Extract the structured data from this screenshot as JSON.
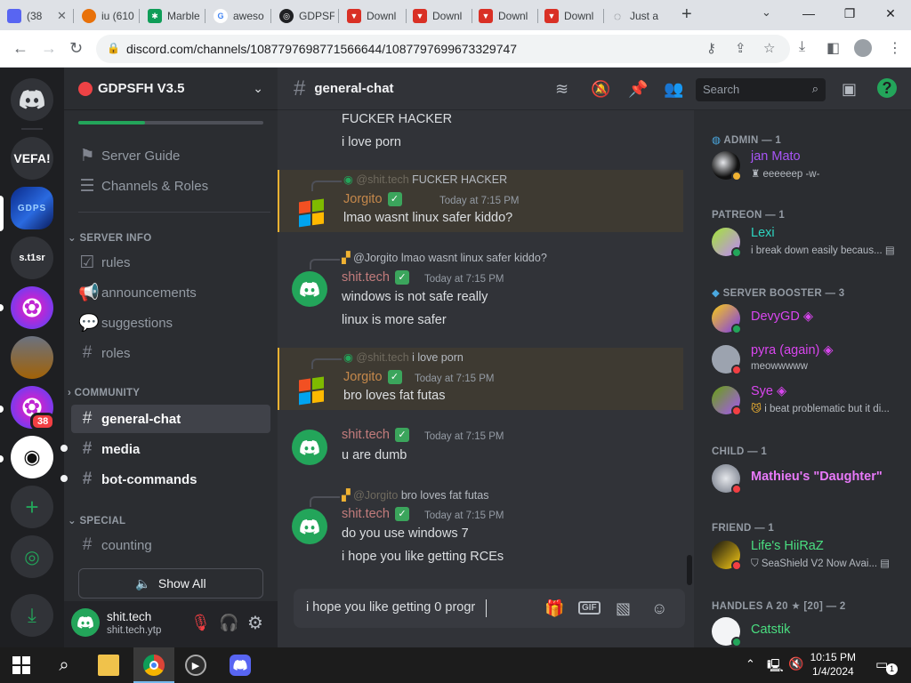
{
  "browser": {
    "tabs": [
      {
        "title": "(38",
        "favicon_color": "#5865f2",
        "favicon_text": "38"
      },
      {
        "title": "iu (610",
        "favicon_color": "#e8710a",
        "favicon_text": "●"
      },
      {
        "title": "Marble",
        "favicon_color": "#0f9d58",
        "favicon_text": "✱"
      },
      {
        "title": "aweso",
        "favicon_color": "#4285f4",
        "favicon_text": "G"
      },
      {
        "title": "GDPSF",
        "favicon_color": "#202124",
        "favicon_text": "◎"
      },
      {
        "title": "Downl",
        "favicon_color": "#d93025",
        "favicon_text": "▼"
      },
      {
        "title": "Downl",
        "favicon_color": "#d93025",
        "favicon_text": "▼"
      },
      {
        "title": "Downl",
        "favicon_color": "#d93025",
        "favicon_text": "▼"
      },
      {
        "title": "Downl",
        "favicon_color": "#d93025",
        "favicon_text": "▼"
      },
      {
        "title": "Just a",
        "favicon_color": "#5f6368",
        "favicon_text": "◌"
      }
    ],
    "url": "discord.com/channels/1087797698771566644/1087797699673329747"
  },
  "guilds": {
    "vefa_label": "VEFA!",
    "st1sr_label": "s.t1sr",
    "mention_badge": "38"
  },
  "server": {
    "name": "GDPSFH V3.5",
    "items_top": [
      {
        "label": "Server Guide",
        "icon": "signpost-icon"
      },
      {
        "label": "Channels & Roles",
        "icon": "list-icon"
      }
    ],
    "categories": [
      {
        "name": "SERVER INFO",
        "channels": [
          {
            "label": "rules",
            "icon": "rules-icon"
          },
          {
            "label": "announcements",
            "icon": "megaphone-icon"
          },
          {
            "label": "suggestions",
            "icon": "forum-icon"
          },
          {
            "label": "roles",
            "icon": "hash-icon"
          }
        ]
      },
      {
        "name": "COMMUNITY",
        "channels": [
          {
            "label": "general-chat",
            "icon": "hash-icon"
          },
          {
            "label": "media",
            "icon": "hash-icon"
          },
          {
            "label": "bot-commands",
            "icon": "hash-icon"
          }
        ]
      },
      {
        "name": "SPECIAL",
        "channels": [
          {
            "label": "counting",
            "icon": "hash-icon"
          }
        ]
      }
    ],
    "show_all_label": "Show All",
    "user": {
      "name": "shit.tech",
      "tag": "shit.tech.ytp"
    }
  },
  "chat": {
    "channel_name": "general-chat",
    "search_placeholder": "Search",
    "messages": [
      {
        "text1": "FUCKER HACKER",
        "text2": "i love porn"
      },
      {
        "reply_name": "@shit.tech",
        "reply_text": "FUCKER HACKER",
        "author": "Jorgito",
        "time": "Today at 7:15 PM",
        "text1": "lmao wasnt linux safer kiddo?"
      },
      {
        "reply_name": "@Jorgito",
        "reply_text": "lmao wasnt linux safer kiddo?",
        "author": "shit.tech",
        "time": "Today at 7:15 PM",
        "text1": "windows is not safe really",
        "text2": "linux is more safer"
      },
      {
        "reply_name": "@shit.tech",
        "reply_text": "i love porn",
        "author": "Jorgito",
        "time": "Today at 7:15 PM",
        "text1": "bro loves fat futas"
      },
      {
        "author": "shit.tech",
        "time": "Today at 7:15 PM",
        "text1": "u are dumb"
      },
      {
        "reply_name": "@Jorgito",
        "reply_text": "bro loves fat futas",
        "author": "shit.tech",
        "time": "Today at 7:15 PM",
        "text1": "do you use windows 7",
        "text2": "i hope you like getting RCEs"
      }
    ],
    "composer_text": "i hope you like getting 0 progr"
  },
  "members": {
    "groups": [
      {
        "role": "ADMIN — 1",
        "members": [
          {
            "name": "jan Mato",
            "status": "eeeeeep -w-",
            "color": "#a855f7"
          }
        ]
      },
      {
        "role": "PATREON — 1",
        "members": [
          {
            "name": "Lexi",
            "status": "i break down easily becaus...",
            "color": "#2dd4bf"
          }
        ]
      },
      {
        "role": "SERVER BOOSTER — 3",
        "members": [
          {
            "name": "DevyGD",
            "status": "",
            "color": "#d946ef"
          },
          {
            "name": "pyra (again)",
            "status": "meowwwww",
            "color": "#d946ef"
          },
          {
            "name": "Sye",
            "status": "i beat problematic but it di...",
            "color": "#d946ef"
          }
        ]
      },
      {
        "role": "CHILD — 1",
        "members": [
          {
            "name": "Mathieu's \"Daughter\"",
            "status": "",
            "color": "#e879f9"
          }
        ]
      },
      {
        "role": "FRIEND — 1",
        "members": [
          {
            "name": "Life's HiiRaZ",
            "status": "SeaShield V2 Now Avai...",
            "color": "#4ade80"
          }
        ]
      },
      {
        "role": "HANDLES A 20 ★ [20] — 2",
        "members": [
          {
            "name": "Catstik",
            "status": "",
            "color": "#4ade80"
          }
        ]
      }
    ]
  },
  "taskbar": {
    "time": "10:15 PM",
    "date": "1/4/2024",
    "notif_count": "1"
  },
  "colors": {
    "discord_bg": "#313338",
    "sidebar_bg": "#2b2d31",
    "guild_bg": "#1e1f22",
    "jorgito_name": "#c5884b",
    "shittech_name": "#c27c7c",
    "highlight_border": "#f0b232",
    "online": "#23a55a",
    "dnd": "#f23f43"
  }
}
